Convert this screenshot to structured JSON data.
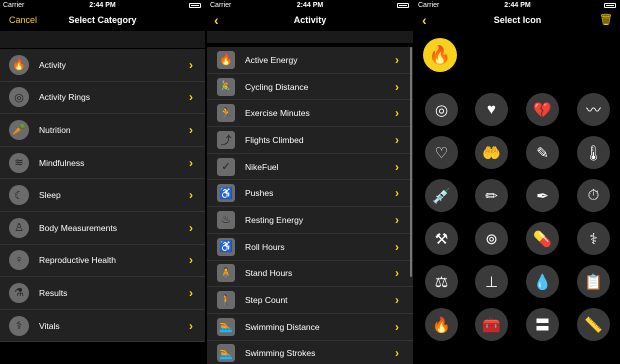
{
  "status": {
    "carrier": "Carrier",
    "time": "2:44 PM"
  },
  "panel1": {
    "cancel": "Cancel",
    "title": "Select Category",
    "items": [
      {
        "label": "Activity",
        "icon": "flame-icon",
        "glyph": "🔥"
      },
      {
        "label": "Activity Rings",
        "icon": "rings-icon",
        "glyph": "◎"
      },
      {
        "label": "Nutrition",
        "icon": "carrot-icon",
        "glyph": "🥕"
      },
      {
        "label": "Mindfulness",
        "icon": "wind-icon",
        "glyph": "≋"
      },
      {
        "label": "Sleep",
        "icon": "moon-icon",
        "glyph": "☾"
      },
      {
        "label": "Body Measurements",
        "icon": "body-icon",
        "glyph": "♙"
      },
      {
        "label": "Reproductive Health",
        "icon": "pregnant-icon",
        "glyph": "♀"
      },
      {
        "label": "Results",
        "icon": "flask-icon",
        "glyph": "⚗"
      },
      {
        "label": "Vitals",
        "icon": "stethoscope-icon",
        "glyph": "⚕"
      }
    ]
  },
  "panel2": {
    "title": "Activity",
    "items": [
      {
        "label": "Active Energy",
        "icon": "flame-icon",
        "glyph": "🔥"
      },
      {
        "label": "Cycling Distance",
        "icon": "bike-icon",
        "glyph": "🚴"
      },
      {
        "label": "Exercise Minutes",
        "icon": "run-icon",
        "glyph": "🏃"
      },
      {
        "label": "Flights Climbed",
        "icon": "stairs-icon",
        "glyph": "⤴"
      },
      {
        "label": "NikeFuel",
        "icon": "swoosh-icon",
        "glyph": "✓"
      },
      {
        "label": "Pushes",
        "icon": "wheelchair-icon",
        "glyph": "♿"
      },
      {
        "label": "Resting Energy",
        "icon": "resting-icon",
        "glyph": "♨"
      },
      {
        "label": "Roll Hours",
        "icon": "wheelchair-icon",
        "glyph": "♿"
      },
      {
        "label": "Stand Hours",
        "icon": "stand-icon",
        "glyph": "🧍"
      },
      {
        "label": "Step Count",
        "icon": "walk-icon",
        "glyph": "🚶"
      },
      {
        "label": "Swimming Distance",
        "icon": "swim-icon",
        "glyph": "🏊"
      },
      {
        "label": "Swimming Strokes",
        "icon": "swim-icon",
        "glyph": "🏊"
      }
    ]
  },
  "panel3": {
    "title": "Select Icon",
    "selected": {
      "icon": "flame-icon",
      "glyph": "🔥"
    },
    "icons": [
      {
        "icon": "rings-icon",
        "glyph": "◎"
      },
      {
        "icon": "heart-icon",
        "glyph": "♥"
      },
      {
        "icon": "broken-heart-icon",
        "glyph": "💔"
      },
      {
        "icon": "ecg-icon",
        "glyph": "〰"
      },
      {
        "icon": "heart-rate-icon",
        "glyph": "♡"
      },
      {
        "icon": "hand-heart-icon",
        "glyph": "🤲"
      },
      {
        "icon": "inhaler-icon",
        "glyph": "✎"
      },
      {
        "icon": "thermometer-icon",
        "glyph": "🌡"
      },
      {
        "icon": "syringe-icon",
        "glyph": "💉"
      },
      {
        "icon": "injector-icon",
        "glyph": "✏"
      },
      {
        "icon": "dropper-icon",
        "glyph": "✒"
      },
      {
        "icon": "glucose-meter-icon",
        "glyph": "⏱"
      },
      {
        "icon": "blood-pressure-icon",
        "glyph": "⚒"
      },
      {
        "icon": "condom-icon",
        "glyph": "⊚"
      },
      {
        "icon": "pill-icon",
        "glyph": "💊"
      },
      {
        "icon": "stethoscope-icon",
        "glyph": "⚕"
      },
      {
        "icon": "scale-icon",
        "glyph": "⚖"
      },
      {
        "icon": "height-icon",
        "glyph": "⊥"
      },
      {
        "icon": "blood-drop-icon",
        "glyph": "💧"
      },
      {
        "icon": "medical-record-icon",
        "glyph": "📋"
      },
      {
        "icon": "flame-icon",
        "glyph": "🔥"
      },
      {
        "icon": "first-aid-icon",
        "glyph": "🧰"
      },
      {
        "icon": "tape-measure-icon",
        "glyph": "〓"
      },
      {
        "icon": "ruler-icon",
        "glyph": "📏"
      }
    ]
  },
  "colors": {
    "accent": "#f7d11e",
    "background": "#000000",
    "cell": "#222222",
    "icon_bg": "#3a3a3a"
  }
}
